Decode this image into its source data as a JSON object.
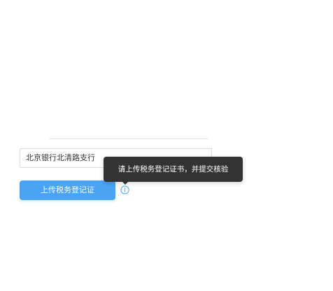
{
  "form": {
    "bank_value": "北京银行北清路支行",
    "upload_button_label": "上传税务登记证"
  },
  "tooltip": {
    "text": "请上传税务登记证书，并提交核验"
  },
  "icons": {
    "info": "info-icon"
  },
  "colors": {
    "primary": "#4aa3f3",
    "tooltip_bg": "#333333",
    "border": "#d9dde3"
  }
}
